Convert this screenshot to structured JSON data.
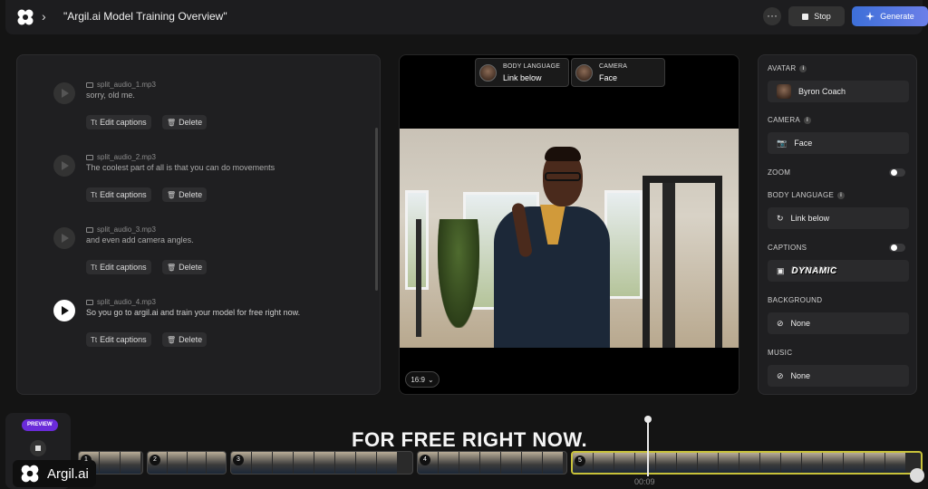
{
  "header": {
    "title": "\"Argil.ai Model Training Overview\"",
    "stop_label": "Stop",
    "generate_label": "Generate"
  },
  "clips": [
    {
      "file": "split_audio_1.mp3",
      "text": "sorry, old me.",
      "playing": false
    },
    {
      "file": "split_audio_2.mp3",
      "text": "The coolest part of all is that you can do movements",
      "playing": false
    },
    {
      "file": "split_audio_3.mp3",
      "text": "and even add camera angles.",
      "playing": false
    },
    {
      "file": "split_audio_4.mp3",
      "text": "So you go to argil.ai and train your model for free right now.",
      "playing": true
    }
  ],
  "clip_actions": {
    "edit": "Edit captions",
    "delete": "Delete"
  },
  "preview": {
    "chips": [
      {
        "label": "BODY LANGUAGE",
        "value": "Link below"
      },
      {
        "label": "CAMERA",
        "value": "Face"
      }
    ],
    "aspect": "16:9"
  },
  "settings": {
    "avatar_label": "AVATAR",
    "avatar_value": "Byron Coach",
    "camera_label": "CAMERA",
    "camera_value": "Face",
    "zoom_label": "ZOOM",
    "body_label": "BODY LANGUAGE",
    "body_value": "Link below",
    "captions_label": "CAPTIONS",
    "captions_value": "DYNAMIC",
    "background_label": "BACKGROUND",
    "background_value": "None",
    "music_label": "MUSIC",
    "music_value": "None"
  },
  "timeline": {
    "preview_badge": "PREVIEW",
    "caption": "FOR FREE RIGHT NOW.",
    "segments": [
      "1",
      "2",
      "3",
      "4",
      "5"
    ],
    "timecode": "00:09",
    "brand": "Argil.ai"
  }
}
